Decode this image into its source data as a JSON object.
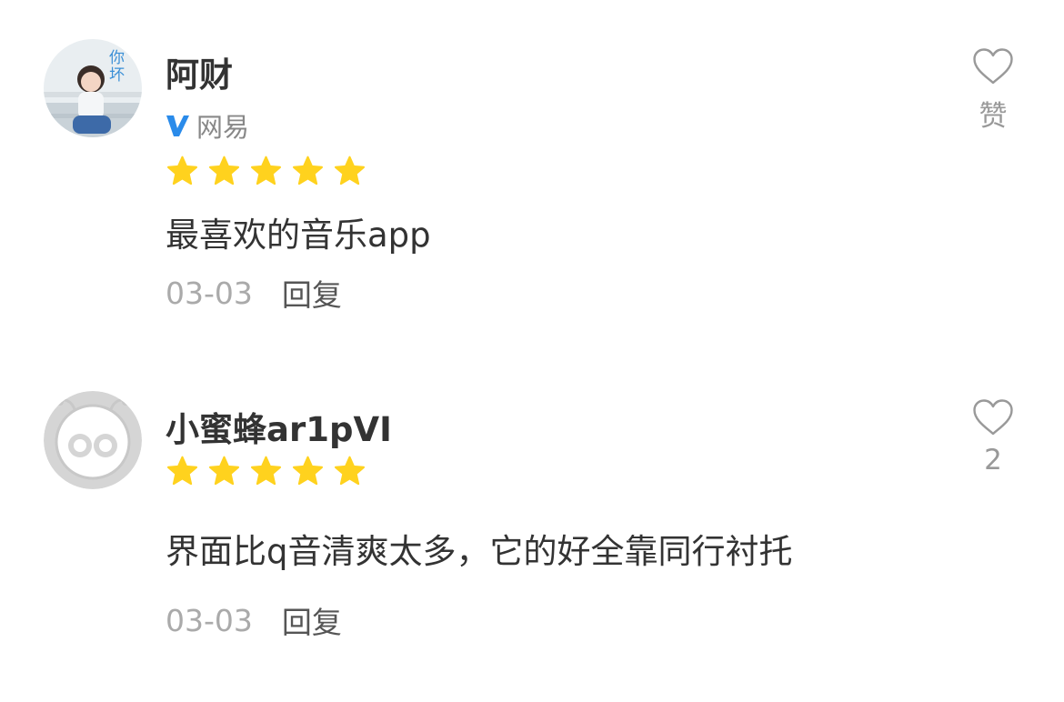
{
  "colors": {
    "star": "#FFD21E",
    "verified": "#2A8BEA",
    "muted": "#AAAAAA",
    "text": "#333333"
  },
  "reviews": [
    {
      "avatar_icon": "girl-photo-avatar",
      "avatar_text": "你坏",
      "name": "阿财",
      "verified_org": "网易",
      "rating": 5,
      "content": "最喜欢的音乐app",
      "date": "03-03",
      "reply_label": "回复",
      "like_label": "赞"
    },
    {
      "avatar_icon": "default-bee-avatar",
      "name": "小蜜蜂ar1pVI",
      "rating": 5,
      "content": "界面比q音清爽太多，它的好全靠同行衬托",
      "date": "03-03",
      "reply_label": "回复",
      "like_label": "2"
    }
  ]
}
